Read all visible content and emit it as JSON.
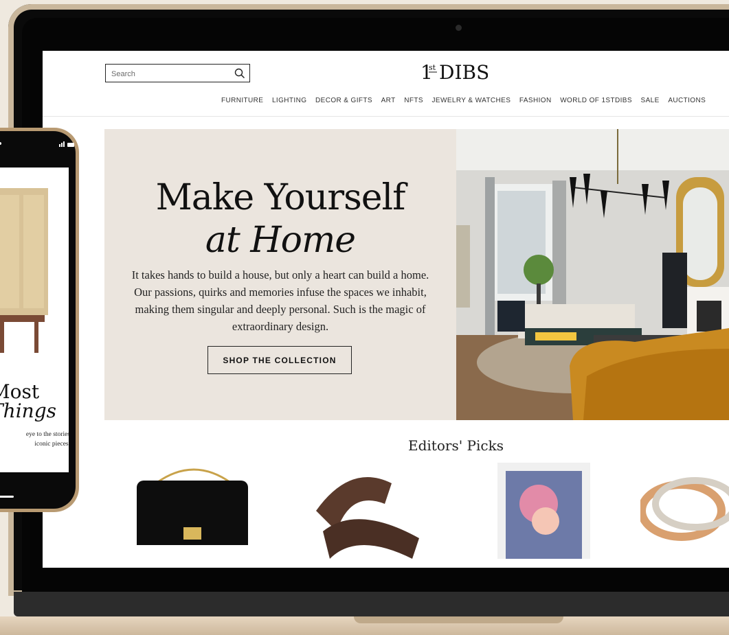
{
  "site": {
    "logo": "1stDIBS",
    "search": {
      "placeholder": "Search",
      "value": ""
    },
    "nav": [
      "FURNITURE",
      "LIGHTING",
      "DECOR & GIFTS",
      "ART",
      "NFTS",
      "JEWELRY & WATCHES",
      "FASHION",
      "WORLD OF 1STDIBS",
      "SALE",
      "AUCTIONS"
    ]
  },
  "hero": {
    "title_line1": "Make Yourself",
    "title_line2": "at Home",
    "body": "It takes hands to build a house, but only a heart can build a home. Our passions, quirks and memories infuse the spaces we inhabit, making them singular and deeply personal. Such is the magic of extraordinary design.",
    "cta": "SHOP THE COLLECTION"
  },
  "editors_picks": {
    "title": "Editors' Picks",
    "items": [
      "handbag",
      "sofa",
      "artwork",
      "rings"
    ]
  },
  "phone": {
    "headline_line1": "Most",
    "headline_line2": "Things",
    "copy_line1": "eye to the stories",
    "copy_line2": "iconic pieces."
  },
  "colors": {
    "hero_panel": "#ebe5de",
    "frame_gold": "#b89a72",
    "background": "#efe9df"
  }
}
